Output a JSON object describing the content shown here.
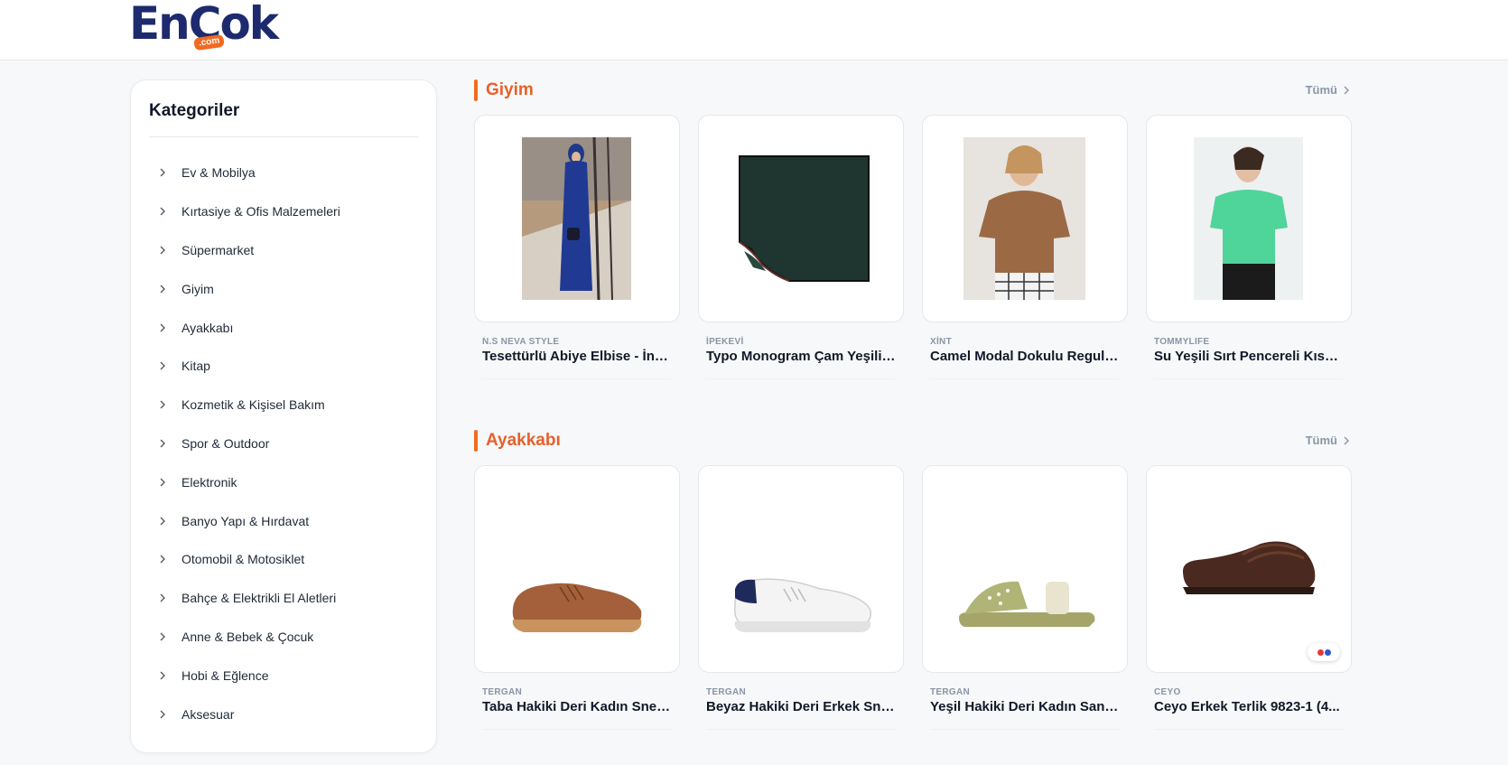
{
  "header": {
    "logo_text": "EnÇok",
    "logo_suffix": ".com"
  },
  "sidebar": {
    "title": "Kategoriler",
    "items": [
      {
        "label": "Ev & Mobilya"
      },
      {
        "label": "Kırtasiye & Ofis Malzemeleri"
      },
      {
        "label": "Süpermarket"
      },
      {
        "label": "Giyim"
      },
      {
        "label": "Ayakkabı"
      },
      {
        "label": "Kitap"
      },
      {
        "label": "Kozmetik & Kişisel Bakım"
      },
      {
        "label": "Spor & Outdoor"
      },
      {
        "label": "Elektronik"
      },
      {
        "label": "Banyo Yapı & Hırdavat"
      },
      {
        "label": "Otomobil & Motosiklet"
      },
      {
        "label": "Bahçe & Elektrikli El Aletleri"
      },
      {
        "label": "Anne & Bebek & Çocuk"
      },
      {
        "label": "Hobi & Eğlence"
      },
      {
        "label": "Aksesuar"
      }
    ]
  },
  "sections": [
    {
      "title": "Giyim",
      "more_label": "Tümü",
      "products": [
        {
          "brand": "N.S NEVA STYLE",
          "title": "Tesettürlü Abiye Elbise - İnci..."
        },
        {
          "brand": "İPEKEVİ",
          "title": "Typo Monogram Çam Yeşili ..."
        },
        {
          "brand": "XİNT",
          "title": "Camel Modal Dokulu Regular..."
        },
        {
          "brand": "TOMMYLIFE",
          "title": "Su Yeşili Sırt Pencereli Kısa ..."
        }
      ]
    },
    {
      "title": "Ayakkabı",
      "more_label": "Tümü",
      "products": [
        {
          "brand": "TERGAN",
          "title": "Taba Hakiki Deri Kadın Snea..."
        },
        {
          "brand": "TERGAN",
          "title": "Beyaz Hakiki Deri Erkek Sne..."
        },
        {
          "brand": "TERGAN",
          "title": "Yeşil Hakiki Deri Kadın Sand..."
        },
        {
          "brand": "CEYO",
          "title": "Ceyo Erkek Terlik 9823-1 (4..."
        }
      ]
    }
  ],
  "colors": {
    "accent": "#f26a21",
    "brand_navy": "#1e2a6e",
    "section_title": "#e8602a"
  }
}
